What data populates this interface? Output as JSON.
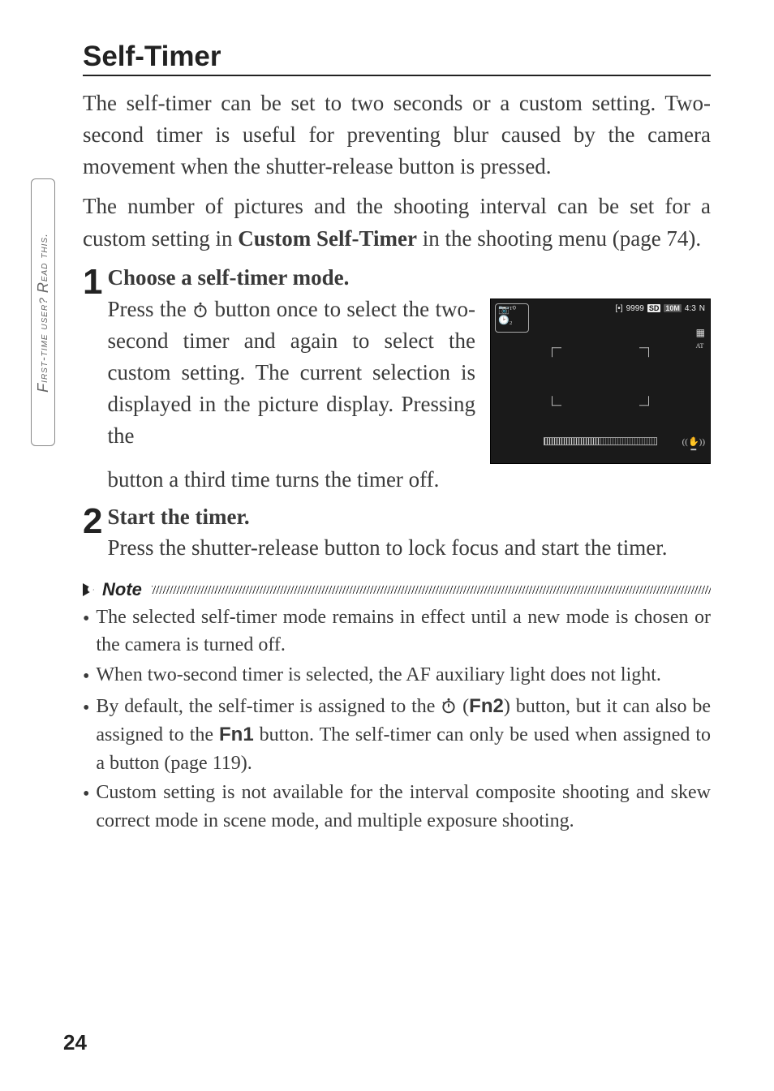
{
  "sideTab": "First-time user? Read this.",
  "heading": "Self-Timer",
  "intro1": "The self-timer can be set to two seconds or a custom setting. Two-second timer is useful for preventing blur caused by the camera movement when the shutter-release button is pressed.",
  "intro2a": "The number of pictures and the shooting interval can be set for a custom setting in ",
  "intro2b": "Custom Self-Timer",
  "intro2c": " in the shooting menu (page 74).",
  "step1": {
    "num": "1",
    "title": "Choose a self-timer mode.",
    "textA": "Press the ",
    "textB": " button once to select the two-second timer and again to select the custom setting. The current selection is displayed in the picture display. Pressing the",
    "textCont": "button a third time turns the timer off."
  },
  "step2": {
    "num": "2",
    "title": "Start the timer.",
    "text": "Press the shutter-release button to lock focus and start the timer."
  },
  "noteLabel": "Note",
  "bullets": {
    "b1": "The selected self-timer mode remains in effect until a new mode is chosen or the camera is turned off.",
    "b2": "When two-second timer is selected, the AF auxiliary light does not light.",
    "b3a": "By default, the self-timer is assigned to the ",
    "b3b": " (",
    "b3c": "Fn2",
    "b3d": ") button, but it can also be assigned to the ",
    "b3e": "Fn1",
    "b3f": " button. The self-timer can only be used when assigned to a button (page 119).",
    "b4": "Custom setting is not available for the interval composite shooting and skew correct mode in scene mode, and multiple exposure shooting."
  },
  "screenshot": {
    "count": "9999",
    "sd": "SD",
    "res": "10M",
    "ratio": "4:3",
    "q": "N",
    "at": "AT"
  },
  "pageNum": "24"
}
